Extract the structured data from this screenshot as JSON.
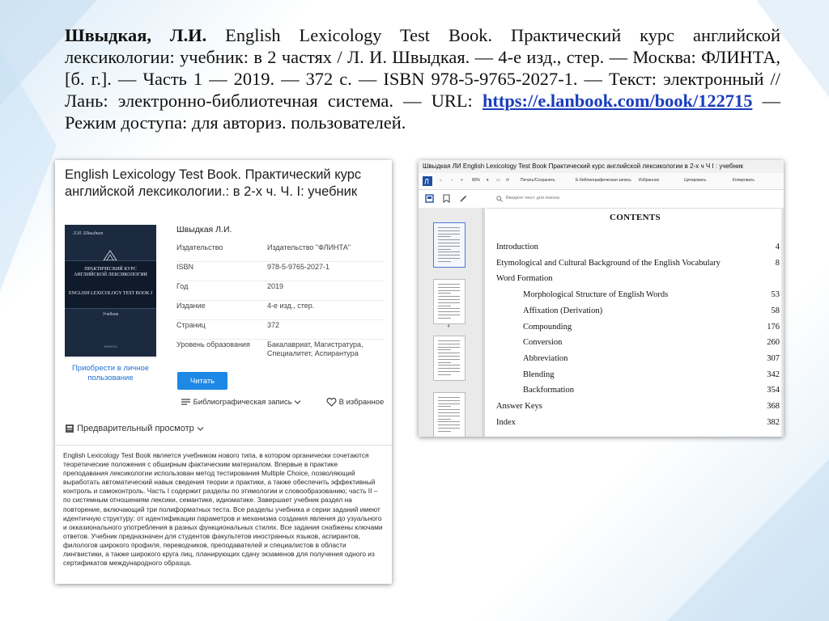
{
  "citation": {
    "author": "Швыдкая, Л.И.",
    "text": " English Lexicology Test Book. Практический курс английской лексикологии: учебник: в 2 частях / Л. И. Швыдкая. — 4-е изд., стер. — Москва: ФЛИНТА, [б. г.]. — Часть 1 — 2019. — 372 с. — ISBN 978-5-9765-2027-1. — Текст: электронный // Лань: электронно-библиотечная система. — URL: ",
    "url": "https://e.lanbook.com/book/122715",
    "text_after": " — Режим доступа: для авториз. пользователей."
  },
  "lanbook": {
    "book_title": "English Lexicology Test Book. Практический курс английской лексикологии.: в 2-х ч. Ч. I: учебник",
    "cover": {
      "author": "Л.И. Швыдкая",
      "title_ru": "ПРАКТИЧЕСКИЙ КУРС АНГЛИЙСКОЙ ЛЕКСИКОЛОГИИ",
      "title_en": "ENGLISH LEXICOLOGY TEST BOOK I",
      "edition": "Учебник",
      "publisher": "ФЛИНТА"
    },
    "buy_link": "Приобрести в личное пользование",
    "author": "Швыдкая Л.И.",
    "meta": [
      {
        "key": "Издательство",
        "value": "Издательство \"ФЛИНТА\""
      },
      {
        "key": "ISBN",
        "value": "978-5-9765-2027-1"
      },
      {
        "key": "Год",
        "value": "2019"
      },
      {
        "key": "Издание",
        "value": "4-е изд., стер."
      },
      {
        "key": "Страниц",
        "value": "372"
      },
      {
        "key": "Уровень образования",
        "value": "Бакалавриат, Магистратура, Специалитет, Аспирантура"
      }
    ],
    "read_button": "Читать",
    "bib_record": "Библиографическая запись",
    "favorites": "В избранное",
    "preview": "Предварительный просмотр",
    "annotation": "English Lexicology Test Book является учебником нового типа, в котором органически сочетаются теоретические положения с обширным фактическим материалом. Впервые в практике преподавания лексикологии использован метод тестирования Multiple Choice, позволяющий выработать автоматический навык сведения теории и практики, а также обеспечить эффективный контроль и самоконтроль. Часть I содержит разделы по этимологии и словообразованию; часть II – по системным отношениям лексики, семантике, идиоматике. Завершает учебник раздел на повторение, включающий три полиформатных теста. Все разделы учебника и серии заданий имеют идентичную структуру: от идентификации параметров и механизма создания явления до узуального и окказионального употребления в разных функциональных стилях. Все задания снабжены ключами ответов. Учебник предназначен для студентов факультетов иностранных языков, аспирантов, филологов широкого профиля, переводчиков, преподавателей и специалистов в области лингвистики, а также широкого круга лиц, планирующих сдачу экзаменов для получения одного из сертификатов международного образца."
  },
  "viewer": {
    "window_title": "Швыдкая ЛИ English Lexicology Test Book Практический курс английской лексикологии в 2-х ч Ч I : учебник",
    "zoom": "80%",
    "toolbar": [
      "Печать/Сохранить",
      "Е-библиографическая запись",
      "Избранное",
      "Цитировать",
      "Копировать"
    ],
    "search_placeholder": "Введите текст для поиска",
    "thumb_page": "4",
    "toc_title": "CONTENTS",
    "toc": [
      {
        "title": "Introduction",
        "page": "4",
        "indent": false
      },
      {
        "title": "Etymological and Cultural Background of the English Vocabulary",
        "page": "8",
        "indent": false
      },
      {
        "title": "Word  Formation",
        "page": "",
        "indent": false
      },
      {
        "title": "Morphological Structure of English Words",
        "page": "53",
        "indent": true
      },
      {
        "title": "Affixation  (Derivation)",
        "page": "58",
        "indent": true
      },
      {
        "title": "Compounding",
        "page": "176",
        "indent": true
      },
      {
        "title": "Conversion",
        "page": "260",
        "indent": true
      },
      {
        "title": "Abbreviation",
        "page": "307",
        "indent": true
      },
      {
        "title": "Blending",
        "page": "342",
        "indent": true
      },
      {
        "title": "Backformation",
        "page": "354",
        "indent": true
      },
      {
        "title": "Answer Keys",
        "page": "368",
        "indent": false
      },
      {
        "title": "Index",
        "page": "382",
        "indent": false
      }
    ]
  }
}
